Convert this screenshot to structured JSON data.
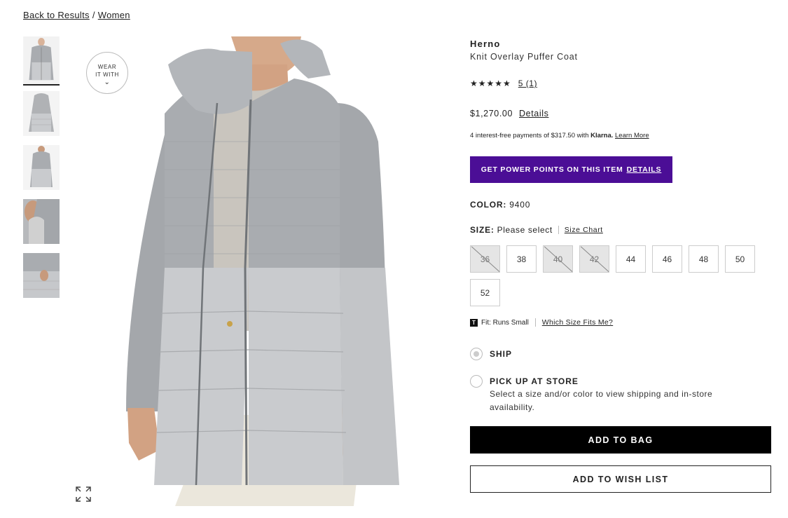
{
  "breadcrumb": {
    "back": "Back to Results",
    "separator": "/",
    "category": "Women"
  },
  "wear_it_with": {
    "line1": "WEAR",
    "line2": "IT WITH"
  },
  "product": {
    "brand": "Herno",
    "name": "Knit Overlay Puffer Coat",
    "stars": "★★★★★",
    "rating_link": "5 (1)",
    "price": "$1,270.00",
    "price_details": "Details",
    "klarna_prefix": "4 interest-free payments of $317.50 with",
    "klarna_brand": "Klarna.",
    "klarna_learn": "Learn More"
  },
  "power_points": {
    "text": "GET POWER POINTS ON THIS ITEM",
    "link": "DETAILS"
  },
  "color": {
    "label": "COLOR:",
    "value": "9400"
  },
  "size": {
    "label": "SIZE:",
    "prompt": "Please select",
    "chart_link": "Size Chart",
    "options": [
      {
        "label": "36",
        "available": false
      },
      {
        "label": "38",
        "available": true
      },
      {
        "label": "40",
        "available": false
      },
      {
        "label": "42",
        "available": false
      },
      {
        "label": "44",
        "available": true
      },
      {
        "label": "46",
        "available": true
      },
      {
        "label": "48",
        "available": true
      },
      {
        "label": "50",
        "available": true
      },
      {
        "label": "52",
        "available": true
      }
    ]
  },
  "fit": {
    "icon": "T",
    "text": "Fit: Runs Small",
    "link": "Which Size Fits Me?"
  },
  "fulfillment": {
    "ship": "SHIP",
    "pickup": "PICK UP AT STORE",
    "pickup_note": "Select a size and/or color to view shipping and in-store availability."
  },
  "actions": {
    "add_to_bag": "ADD TO BAG",
    "add_to_wish": "ADD TO WISH LIST"
  },
  "colors": {
    "power_purple": "#4b0e96",
    "coat_gray": "#a9acb0",
    "puffer_gray": "#c9cbce"
  }
}
